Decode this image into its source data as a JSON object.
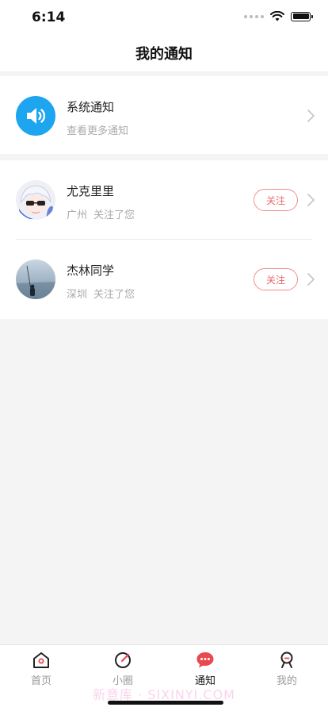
{
  "status": {
    "time": "6:14"
  },
  "nav": {
    "title": "我的通知"
  },
  "system_notice": {
    "title": "系统通知",
    "subtitle": "查看更多通知",
    "icon": "speaker-icon",
    "icon_color": "#1ea5ef"
  },
  "followers": [
    {
      "name": "尤克里里",
      "city": "广州",
      "action": "关注了您",
      "button": "关注"
    },
    {
      "name": "杰林同学",
      "city": "深圳",
      "action": "关注了您",
      "button": "关注"
    }
  ],
  "tabs": [
    {
      "label": "首页",
      "icon": "home-icon",
      "active": false
    },
    {
      "label": "小圈",
      "icon": "circle-icon",
      "active": false
    },
    {
      "label": "通知",
      "icon": "message-icon",
      "active": true
    },
    {
      "label": "我的",
      "icon": "profile-icon",
      "active": false
    }
  ],
  "colors": {
    "accent_red": "#e8494f",
    "follow_border": "#f08f8f",
    "system_blue": "#1ea5ef"
  },
  "watermark": "新意库 · SIXINYI.COM"
}
